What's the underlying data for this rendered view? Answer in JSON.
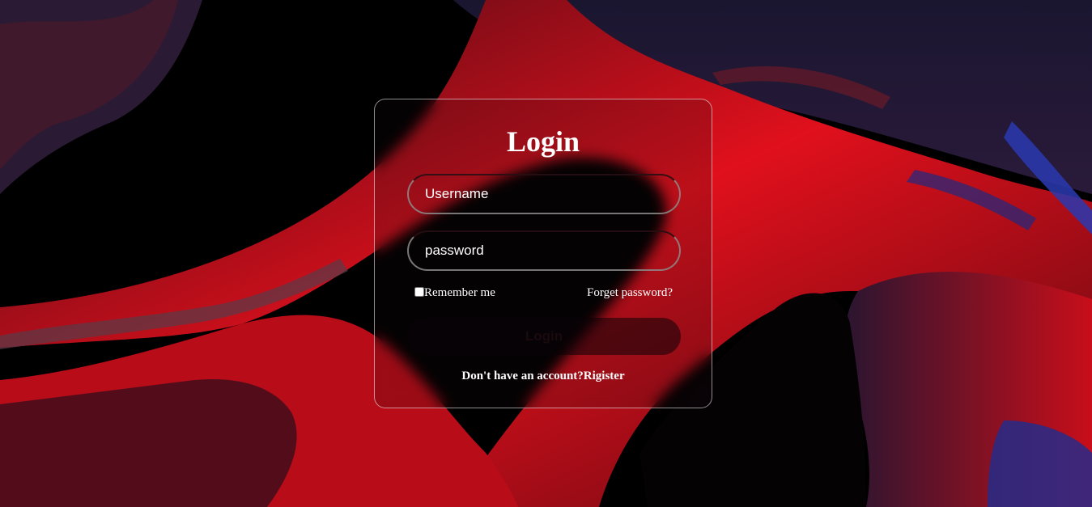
{
  "login": {
    "title": "Login",
    "username_placeholder": "Username",
    "password_placeholder": "password",
    "remember_label": "Remember me",
    "forgot_label": "Forget password?",
    "submit_label": "Login",
    "register_prompt": "Don't have an account?",
    "register_link": "Rigister"
  },
  "colors": {
    "accent_red": "#e0101c",
    "background": "#000000",
    "text": "#ffffff"
  }
}
